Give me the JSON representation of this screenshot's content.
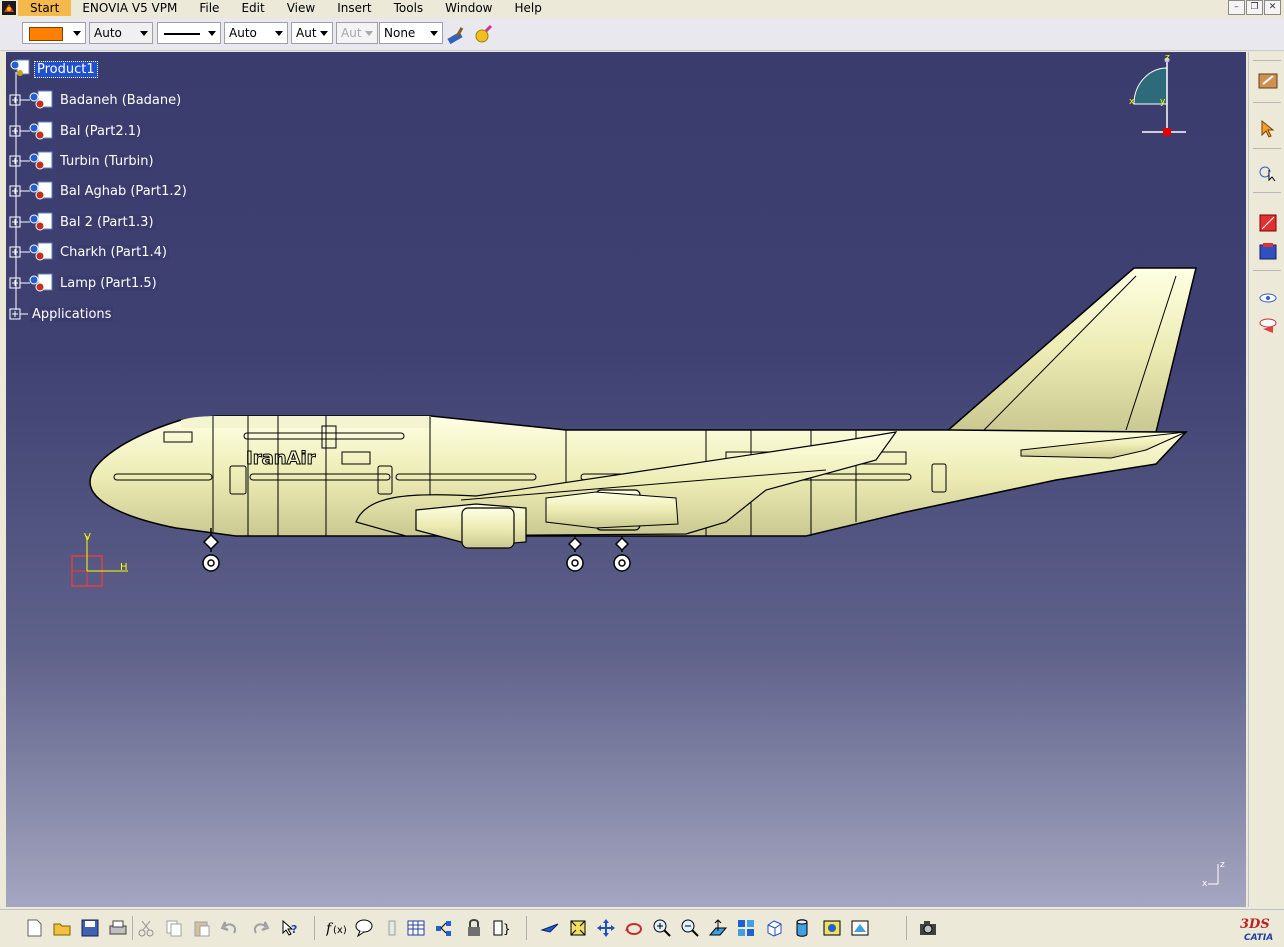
{
  "menubar": {
    "items": [
      {
        "label": "Start"
      },
      {
        "label": "ENOVIA V5 VPM"
      },
      {
        "label": "File"
      },
      {
        "label": "Edit"
      },
      {
        "label": "View"
      },
      {
        "label": "Insert"
      },
      {
        "label": "Tools"
      },
      {
        "label": "Window"
      },
      {
        "label": "Help"
      }
    ]
  },
  "toolbar": {
    "color_swatch": "#ff8000",
    "layer": "Auto",
    "linetype_icon": "solid-line",
    "thickness": "Auto",
    "thickness2": "Aut",
    "thickness3": "Aut",
    "rendering": "None"
  },
  "tree": {
    "root": "Product1",
    "children": [
      {
        "label": "Badaneh (Badane)"
      },
      {
        "label": "Bal (Part2.1)"
      },
      {
        "label": "Turbin (Turbin)"
      },
      {
        "label": "Bal Aghab (Part1.2)"
      },
      {
        "label": "Bal 2 (Part1.3)"
      },
      {
        "label": "Charkh (Part1.4)"
      },
      {
        "label": "Lamp (Part1.5)"
      }
    ],
    "applications": "Applications"
  },
  "compass": {
    "x": "x",
    "y": "y",
    "z": "z"
  },
  "axis_gizmo": {
    "v": "V",
    "h": "H"
  },
  "corner_axis": {
    "x": "x",
    "z": "z"
  },
  "airplane": {
    "livery": "IranAir",
    "color": "#ececb4",
    "outline": "#000000"
  },
  "branding": {
    "logo_text": "CATIA",
    "logo_mark": "3DS"
  },
  "colors": {
    "viewport_top": "#3a3c6e",
    "viewport_bottom": "#a5a6c0",
    "selection": "#2050d0"
  }
}
